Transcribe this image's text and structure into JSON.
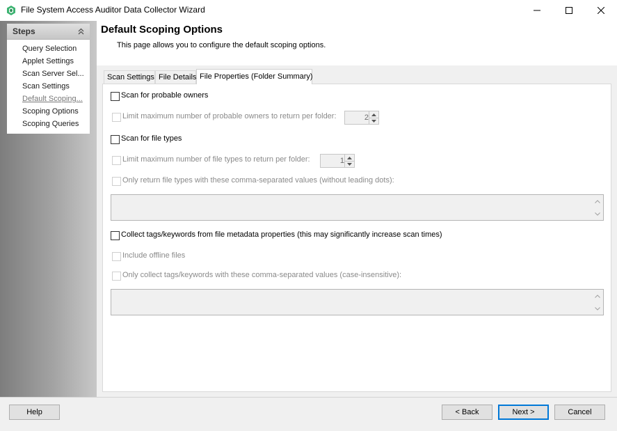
{
  "window": {
    "title": "File System Access Auditor Data Collector Wizard",
    "accent_color": "#3cb371"
  },
  "steps": {
    "header": "Steps",
    "items": [
      {
        "label": "Query Selection",
        "current": false
      },
      {
        "label": "Applet Settings",
        "current": false
      },
      {
        "label": "Scan Server Sel...",
        "current": false
      },
      {
        "label": "Scan Settings",
        "current": false
      },
      {
        "label": "Default Scoping...",
        "current": true
      },
      {
        "label": "Scoping Options",
        "current": false
      },
      {
        "label": "Scoping Queries",
        "current": false
      }
    ]
  },
  "page": {
    "title": "Default Scoping Options",
    "description": "This page allows you to configure the default scoping options."
  },
  "tabs": [
    {
      "label": "Scan Settings",
      "active": false
    },
    {
      "label": "File Details",
      "active": false
    },
    {
      "label": "File Properties (Folder Summary)",
      "active": true
    }
  ],
  "options": {
    "probable_owners": {
      "label": "Scan for probable owners",
      "checked": false
    },
    "limit_owners": {
      "label": "Limit maximum number of probable owners to return per folder:",
      "value": "2",
      "enabled": false
    },
    "file_types": {
      "label": "Scan for file types",
      "checked": false
    },
    "limit_file_types": {
      "label": "Limit maximum number of file types to return per folder:",
      "value": "1",
      "enabled": false
    },
    "only_file_types": {
      "label": "Only return file types with these comma-separated values (without leading dots):",
      "value": "",
      "enabled": false
    },
    "collect_tags": {
      "label": "Collect tags/keywords from file metadata properties (this may significantly increase scan times)",
      "checked": false
    },
    "offline_files": {
      "label": "Include offline files",
      "enabled": false
    },
    "only_tags": {
      "label": "Only collect tags/keywords with these comma-separated values (case-insensitive):",
      "value": "",
      "enabled": false
    }
  },
  "buttons": {
    "help": "Help",
    "back": "< Back",
    "next": "Next >",
    "cancel": "Cancel"
  }
}
